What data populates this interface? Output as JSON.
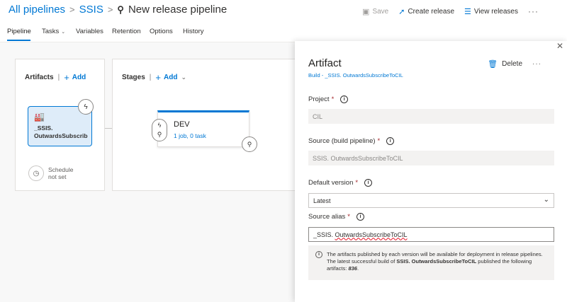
{
  "header": {
    "breadcrumb_all": "All pipelines",
    "breadcrumb_sep": ">",
    "breadcrumb_project": "SSIS",
    "title": "New release pipeline",
    "save_label": "Save",
    "create_release_label": "Create release",
    "view_releases_label": "View releases",
    "more_label": "···"
  },
  "tabs": [
    {
      "label": "Pipeline"
    },
    {
      "label": "Tasks"
    },
    {
      "label": "Variables"
    },
    {
      "label": "Retention"
    },
    {
      "label": "Options"
    },
    {
      "label": "History"
    }
  ],
  "artifacts_panel": {
    "heading": "Artifacts",
    "add_label": "Add",
    "artifact_name_line1": "_SSIS.",
    "artifact_name_line2": "OutwardsSubscrib",
    "schedule_line1": "Schedule",
    "schedule_line2": "not set"
  },
  "stages_panel": {
    "heading": "Stages",
    "add_label": "Add",
    "stage_name": "DEV",
    "stage_jobs": "1 job, 0 task"
  },
  "drawer": {
    "title": "Artifact",
    "subtitle": "Build - _SSIS. OutwardsSubscribeToCIL",
    "delete_label": "Delete",
    "more_label": "···",
    "project_label": "Project",
    "project_value": "CIL",
    "source_label": "Source (build pipeline)",
    "source_value": "SSIS. OutwardsSubscribeToCIL",
    "default_version_label": "Default version",
    "default_version_value": "Latest",
    "alias_label": "Source alias",
    "alias_value_prefix": "_SSIS. ",
    "alias_value_word": "OutwardsSubscribeToCIL",
    "required_mark": "*",
    "message_part1": "The artifacts published by each version will be available for deployment in release pipelines. The latest successful build of ",
    "message_bold": "SSIS. OutwardsSubscribeToCIL",
    "message_part2": " published the following artifacts: ",
    "message_count": "836",
    "message_end": "."
  },
  "colors": {
    "accent": "#0078d4",
    "required": "#a4262c"
  },
  "icons": {
    "pipeline": "pipeline-icon",
    "save": "save-icon",
    "rocket": "rocket-icon",
    "list": "list-icon",
    "build": "build-icon",
    "lightning": "lightning-icon",
    "clock": "clock-icon",
    "person": "person-icon",
    "trash": "trash-icon",
    "close": "close-icon",
    "info": "info-icon"
  }
}
